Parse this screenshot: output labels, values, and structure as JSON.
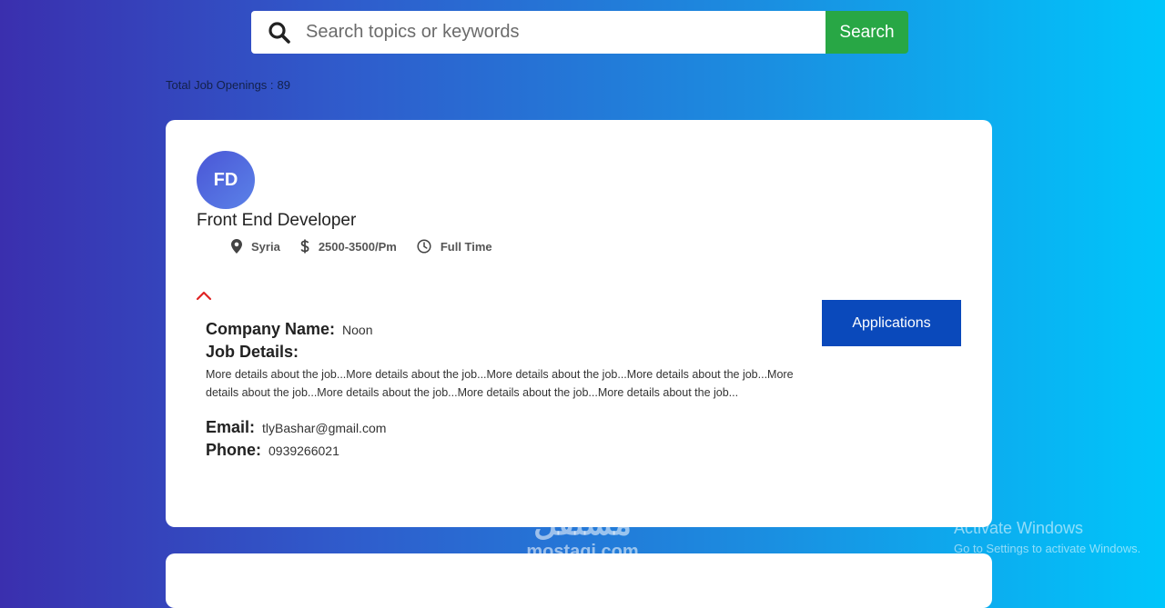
{
  "search": {
    "placeholder": "Search topics or keywords",
    "button_label": "Search"
  },
  "summary": {
    "label": "Total Job Openings :",
    "count": "89"
  },
  "job": {
    "avatar_initials": "FD",
    "title": "Front End Developer",
    "location": "Syria",
    "salary": "2500-3500/Pm",
    "type": "Full Time",
    "applications_label": "Applications",
    "company_label": "Company Name:",
    "company_value": "Noon",
    "details_label": "Job Details:",
    "details_text": "More details about the job...More details about the job...More details about the job...More details about the job...More details about the job...More details about the job...More details about the job...More details about the job...",
    "email_label": "Email:",
    "email_value": "tlyBashar@gmail.com",
    "phone_label": "Phone:",
    "phone_value": "0939266021",
    "icons": {
      "location": "map-pin-icon",
      "salary": "dollar-icon",
      "type": "clock-icon",
      "toggle": "chevron-up-icon"
    }
  },
  "colors": {
    "search_button": "#28a745",
    "applications_button": "#0a49bb",
    "toggle_chevron": "#e02424",
    "avatar": "#4a56d6"
  },
  "watermark": {
    "arabic": "مستقل",
    "latin": "mostaqi.com"
  },
  "os_overlay": {
    "title": "Activate Windows",
    "subtitle": "Go to Settings to activate Windows."
  }
}
